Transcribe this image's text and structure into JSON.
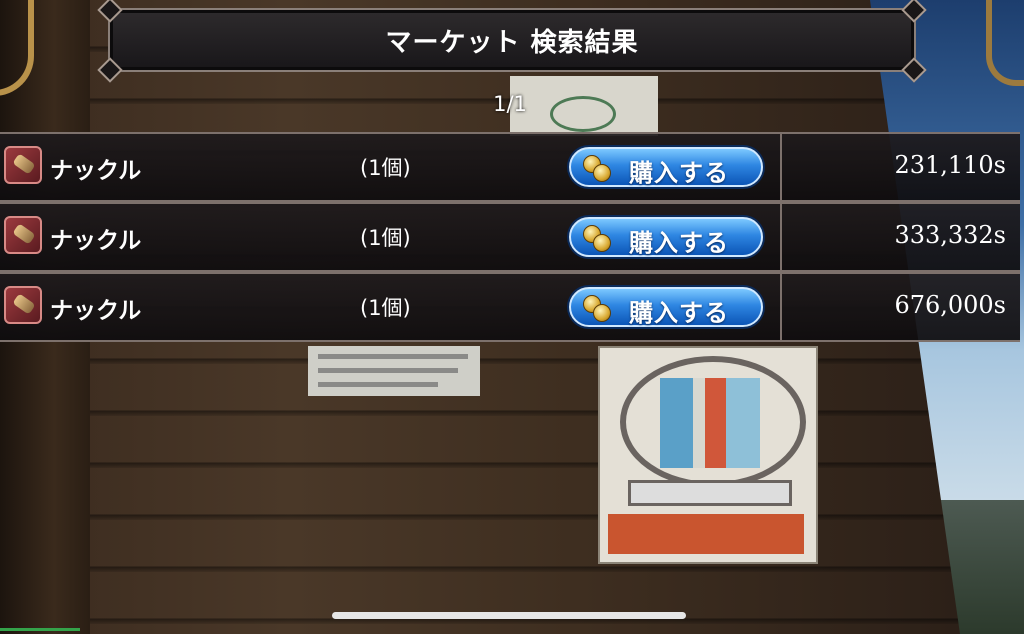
{
  "header": {
    "title": "マーケット 検索結果"
  },
  "pagination": {
    "label": "1/1"
  },
  "results": [
    {
      "item_name": "ナックル",
      "quantity": "(1個)",
      "buy_label": "購入する",
      "price": "231,110s",
      "icon": "knuckle-icon"
    },
    {
      "item_name": "ナックル",
      "quantity": "(1個)",
      "buy_label": "購入する",
      "price": "333,332s",
      "icon": "knuckle-icon"
    },
    {
      "item_name": "ナックル",
      "quantity": "(1個)",
      "buy_label": "購入する",
      "price": "676,000s",
      "icon": "knuckle-icon"
    }
  ],
  "colors": {
    "buy_button": "#2e86e2",
    "row_border": "#7d716c",
    "title_bg": "#1f1c1e"
  }
}
